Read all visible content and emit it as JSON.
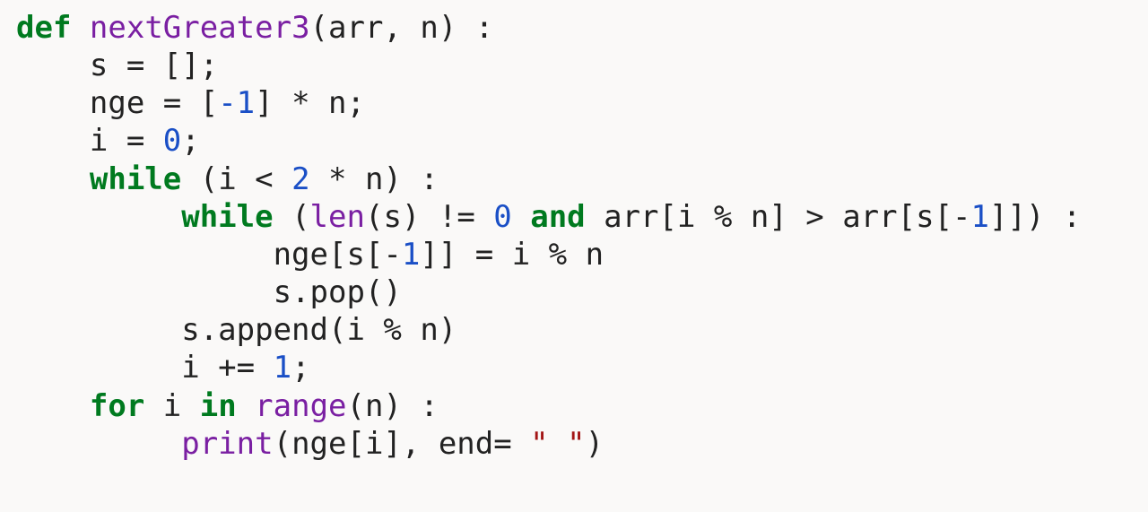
{
  "code": {
    "l1": {
      "kw_def": "def",
      "name": "nextGreater3",
      "params": "(arr, n) :"
    },
    "l2": {
      "text": "s = [];"
    },
    "l3": {
      "lhs": "nge = [",
      "neg1": "-1",
      "rhs": "] * n;"
    },
    "l4": {
      "lhs": "i = ",
      "zero": "0",
      "semi": ";"
    },
    "l5": {
      "kw_while": "while",
      "cond": " (i < ",
      "two": "2",
      "rest": " * n) :"
    },
    "l6": {
      "kw_while": "while",
      "open": " (",
      "len": "len",
      "mid": "(s) != ",
      "zero": "0",
      "kw_and": " and",
      "tail": " arr[i % n] > arr[s[-",
      "one": "1",
      "end": "]]) :"
    },
    "l7": {
      "lhs": "nge[s[-",
      "one": "1",
      "rhs": "]] = i % n"
    },
    "l8": {
      "text": "s.pop()"
    },
    "l9": {
      "text": "s.append(i % n)"
    },
    "l10": {
      "lhs": "i += ",
      "one": "1",
      "semi": ";"
    },
    "l11": {
      "kw_for": "for",
      "mid": " i ",
      "kw_in": "in",
      "sp": " ",
      "range": "range",
      "rest": "(n) :"
    },
    "l12": {
      "print": "print",
      "open": "(nge[i], end= ",
      "str": "\" \"",
      "close": ")"
    }
  }
}
